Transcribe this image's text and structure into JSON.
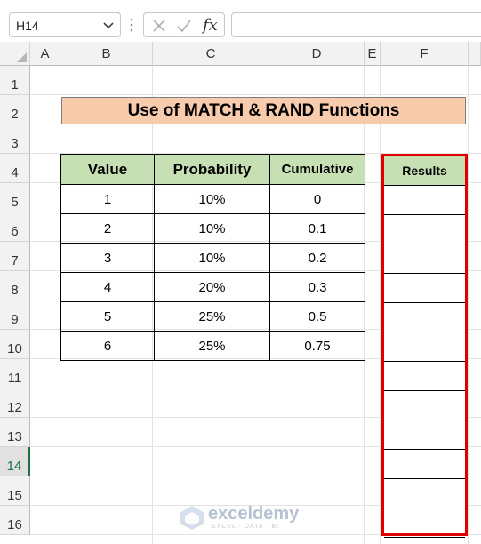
{
  "formula_bar": {
    "name_box": "H14",
    "fx_label": "fx",
    "formula": ""
  },
  "columns": [
    "A",
    "B",
    "C",
    "D",
    "E",
    "F"
  ],
  "rows": [
    "1",
    "2",
    "3",
    "4",
    "5",
    "6",
    "7",
    "8",
    "9",
    "10",
    "11",
    "12",
    "13",
    "14",
    "15",
    "16"
  ],
  "active_row": "14",
  "sheet": {
    "title": "Use of MATCH & RAND Functions",
    "table": {
      "headers": [
        "Value",
        "Probability",
        "Cumulative"
      ],
      "rows": [
        [
          "1",
          "10%",
          "0"
        ],
        [
          "2",
          "10%",
          "0.1"
        ],
        [
          "3",
          "10%",
          "0.2"
        ],
        [
          "4",
          "20%",
          "0.3"
        ],
        [
          "5",
          "25%",
          "0.5"
        ],
        [
          "6",
          "25%",
          "0.75"
        ]
      ]
    },
    "results_header": "Results"
  },
  "watermark": {
    "name": "exceldemy",
    "tagline": "EXCEL · DATA · BI"
  },
  "colors": {
    "title_fill": "#f8cbad",
    "header_fill": "#c6e0b4",
    "highlight_border": "#e00000",
    "active_row": "#1e7145"
  }
}
